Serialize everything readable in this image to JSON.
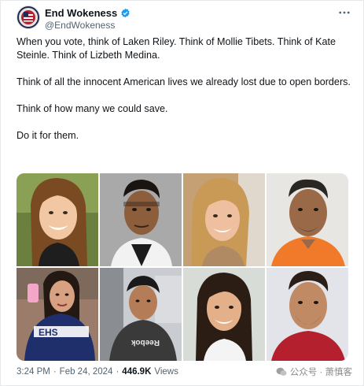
{
  "tweet": {
    "display_name": "End Wokeness",
    "handle": "@EndWokeness",
    "paragraphs": [
      "When you vote, think of Laken Riley. Think of Mollie Tibets. Think of Kate Steinle. Think of Lizbeth Medina.",
      "Think of all the innocent American lives we already lost due to open borders.",
      "Think of how many we could save.",
      "Do it for them."
    ],
    "more_icon": "ellipsis-icon",
    "verified_icon": "verified-badge-icon",
    "accent_color": "#1d9bf0"
  },
  "footer": {
    "time": "3:24 PM",
    "separator": "·",
    "date": "Feb 24, 2024",
    "views_count": "446.9K",
    "views_label": "Views"
  },
  "photos": [
    {
      "description_icon": "photo-1"
    },
    {
      "description_icon": "photo-2"
    }
  ],
  "photo_text": {
    "jacket_letters": "EHS",
    "shirt_text": "Reebok"
  },
  "watermark": {
    "text": "公众号 · 萧慎客"
  }
}
